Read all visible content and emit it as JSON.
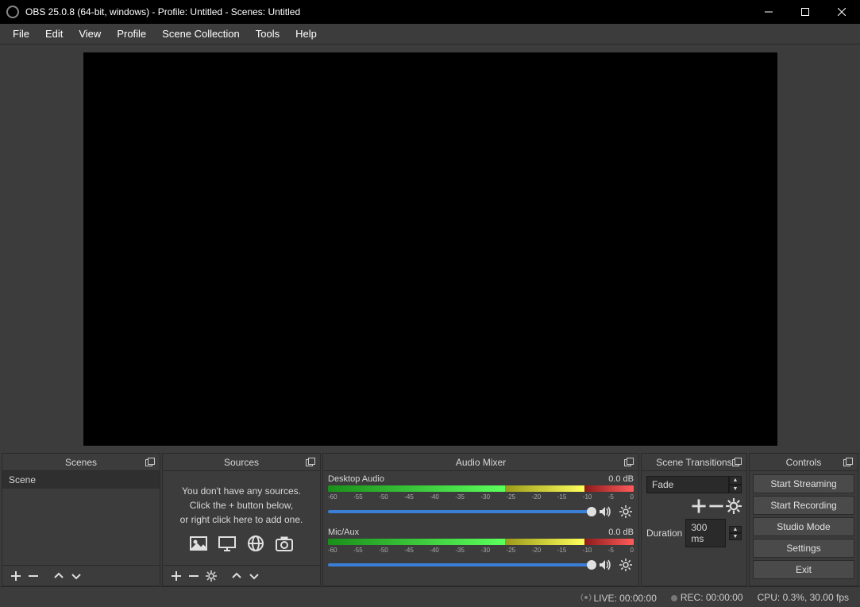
{
  "titlebar": {
    "title": "OBS 25.0.8 (64-bit, windows) - Profile: Untitled - Scenes: Untitled"
  },
  "menu": [
    "File",
    "Edit",
    "View",
    "Profile",
    "Scene Collection",
    "Tools",
    "Help"
  ],
  "dockTitles": {
    "scenes": "Scenes",
    "sources": "Sources",
    "mixer": "Audio Mixer",
    "trans": "Scene Transitions",
    "ctrls": "Controls"
  },
  "scenes": {
    "items": [
      "Scene"
    ]
  },
  "sources": {
    "empty1": "You don't have any sources.",
    "empty2": "Click the + button below,",
    "empty3": "or right click here to add one."
  },
  "mixer": {
    "ticks": [
      "-60",
      "-55",
      "-50",
      "-45",
      "-40",
      "-35",
      "-30",
      "-25",
      "-20",
      "-15",
      "-10",
      "-5",
      "0"
    ],
    "channels": [
      {
        "name": "Desktop Audio",
        "db": "0.0 dB"
      },
      {
        "name": "Mic/Aux",
        "db": "0.0 dB"
      }
    ]
  },
  "transitions": {
    "selected": "Fade",
    "durationLabel": "Duration",
    "duration": "300 ms"
  },
  "controls": [
    "Start Streaming",
    "Start Recording",
    "Studio Mode",
    "Settings",
    "Exit"
  ],
  "status": {
    "live": "LIVE: 00:00:00",
    "rec": "REC: 00:00:00",
    "cpu": "CPU: 0.3%, 30.00 fps"
  }
}
